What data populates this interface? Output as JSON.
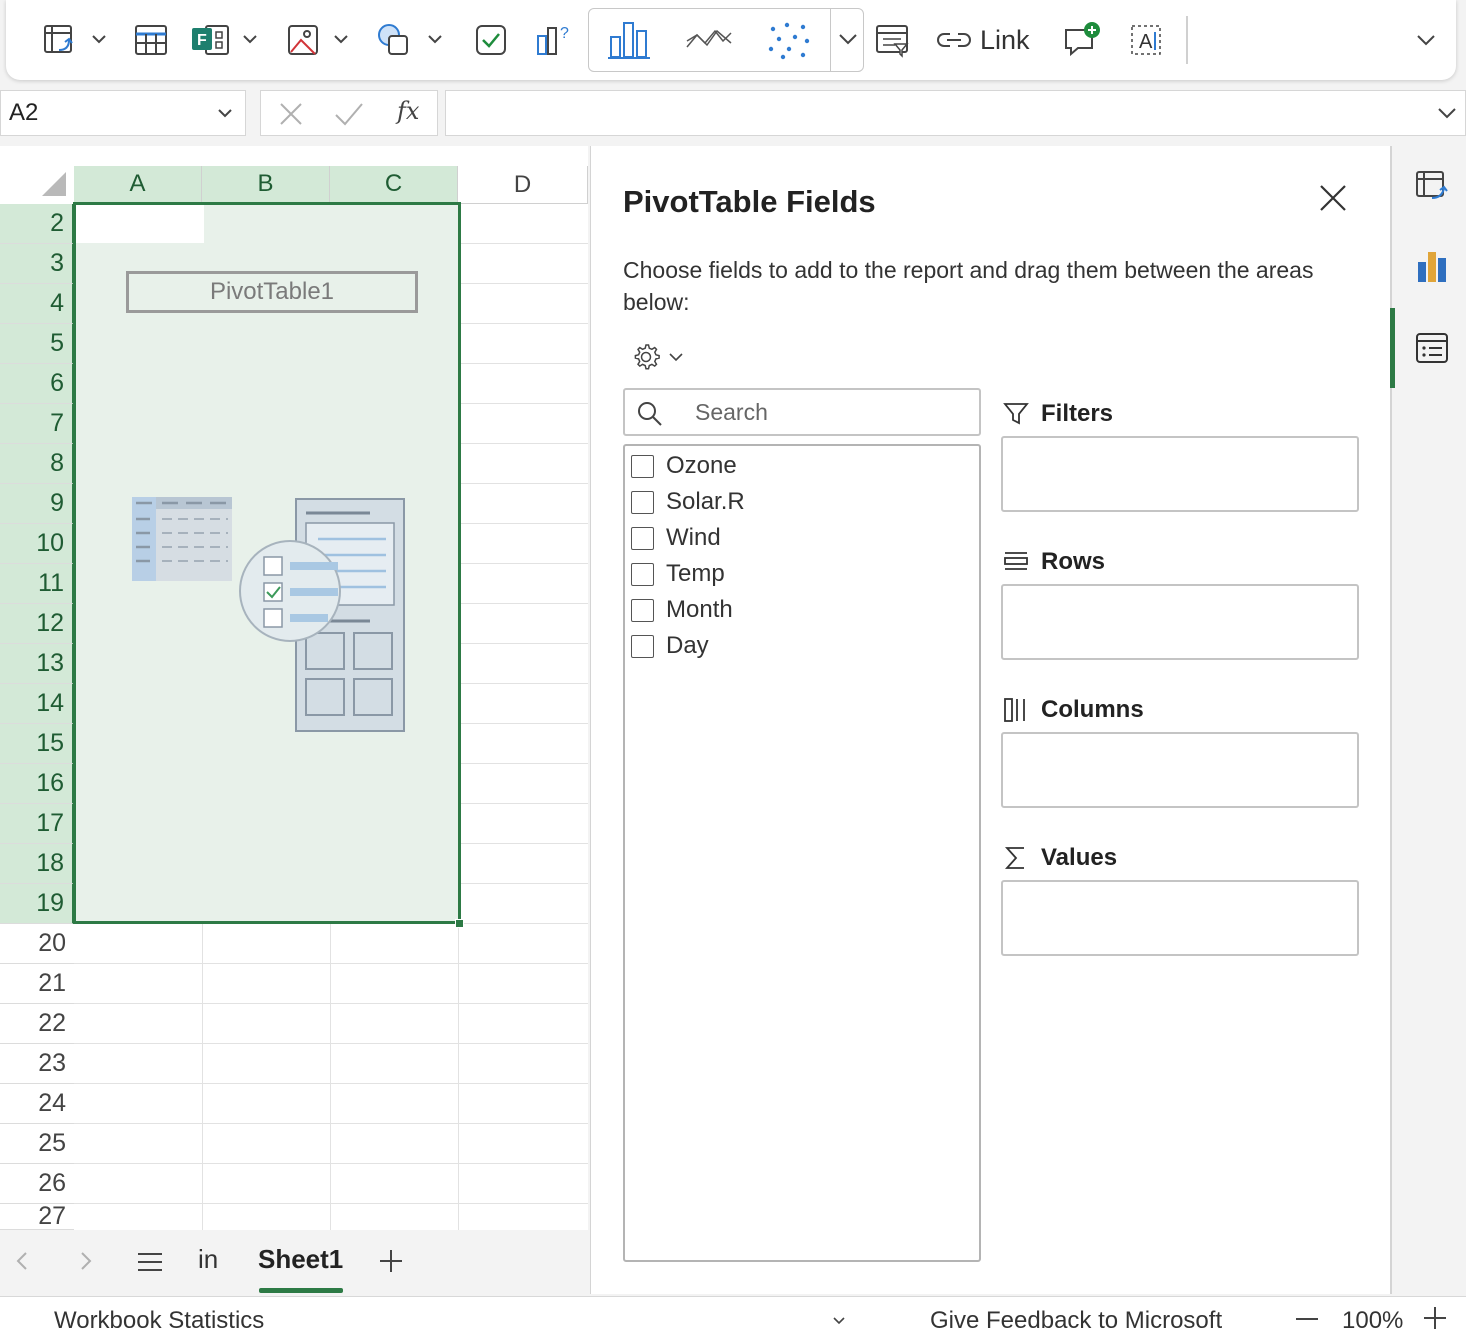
{
  "ribbon": {
    "tools": [
      {
        "icon": "pivot-table-icon",
        "has_menu": true
      },
      {
        "icon": "table-icon",
        "has_menu": false
      },
      {
        "icon": "forms-icon",
        "has_menu": true
      },
      {
        "icon": "picture-icon",
        "has_menu": true
      },
      {
        "icon": "shapes-icon",
        "has_menu": true
      },
      {
        "icon": "checkbox-icon",
        "has_menu": false
      },
      {
        "icon": "recommended-charts-icon",
        "has_menu": false
      }
    ],
    "chart_gallery": [
      "column-chart-icon",
      "line-chart-icon",
      "scatter-chart-icon"
    ],
    "link_label": "Link"
  },
  "formula_bar": {
    "name_box": "A2",
    "fx_label": "fx",
    "formula": ""
  },
  "grid": {
    "columns": [
      "A",
      "B",
      "C",
      "D"
    ],
    "rows": [
      "2",
      "3",
      "4",
      "5",
      "6",
      "7",
      "8",
      "9",
      "10",
      "11",
      "12",
      "13",
      "14",
      "15",
      "16",
      "17",
      "18",
      "19",
      "20",
      "21",
      "22",
      "23",
      "24",
      "25",
      "26",
      "27"
    ],
    "pivot_placeholder": "PivotTable1"
  },
  "sheet_tabs": {
    "tabs": [
      "in",
      "Sheet1"
    ],
    "active": "Sheet1"
  },
  "status_bar": {
    "left": "Workbook Statistics",
    "feedback": "Give Feedback to Microsoft",
    "zoom": "100%"
  },
  "pivot_pane": {
    "title": "PivotTable Fields",
    "description": "Choose fields to add to the report and drag them between the areas below:",
    "search_placeholder": "Search",
    "fields": [
      "Ozone",
      "Solar.R",
      "Wind",
      "Temp",
      "Month",
      "Day"
    ],
    "areas": {
      "filters": "Filters",
      "rows": "Rows",
      "columns": "Columns",
      "values": "Values"
    }
  },
  "colors": {
    "accent": "#2d7a45",
    "selection_fill": "#e8f1ea",
    "header_selected": "#d3e9d7"
  }
}
